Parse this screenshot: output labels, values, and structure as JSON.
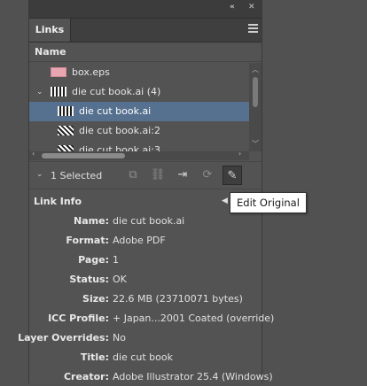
{
  "panel": {
    "collapse_glyph": "«",
    "close_glyph": "✕",
    "tab_label": "Links",
    "column_header": "Name"
  },
  "links": [
    {
      "name": "box.eps",
      "thumb": "pink",
      "indent": 2
    },
    {
      "name": "die cut book.ai (4)",
      "thumb": "pattern",
      "indent": 1,
      "expandable": true
    },
    {
      "name": "die cut book.ai",
      "thumb": "pattern",
      "indent": 3,
      "selected": true
    },
    {
      "name": "die cut book.ai:2",
      "thumb": "pattern2",
      "indent": 3
    },
    {
      "name": "die cut book.ai:3",
      "thumb": "pattern2",
      "indent": 3
    }
  ],
  "toolbar": {
    "selection_count": "1 Selected"
  },
  "link_info": {
    "header": "Link Info",
    "rows": [
      {
        "key": "Name:",
        "value": "die cut book.ai"
      },
      {
        "key": "Format:",
        "value": "Adobe PDF"
      },
      {
        "key": "Page:",
        "value": "1"
      },
      {
        "key": "Status:",
        "value": "OK"
      },
      {
        "key": "Size:",
        "value": "22.6 MB (23710071 bytes)"
      },
      {
        "key": "ICC Profile:",
        "value": "+ Japan...2001 Coated (override)"
      },
      {
        "key": "Layer Overrides:",
        "value": "No"
      },
      {
        "key": "Title:",
        "value": "die cut book"
      },
      {
        "key": "Creator:",
        "value": "Adobe Illustrator 25.4 (Windows)"
      }
    ]
  },
  "tooltip": "Edit Original"
}
